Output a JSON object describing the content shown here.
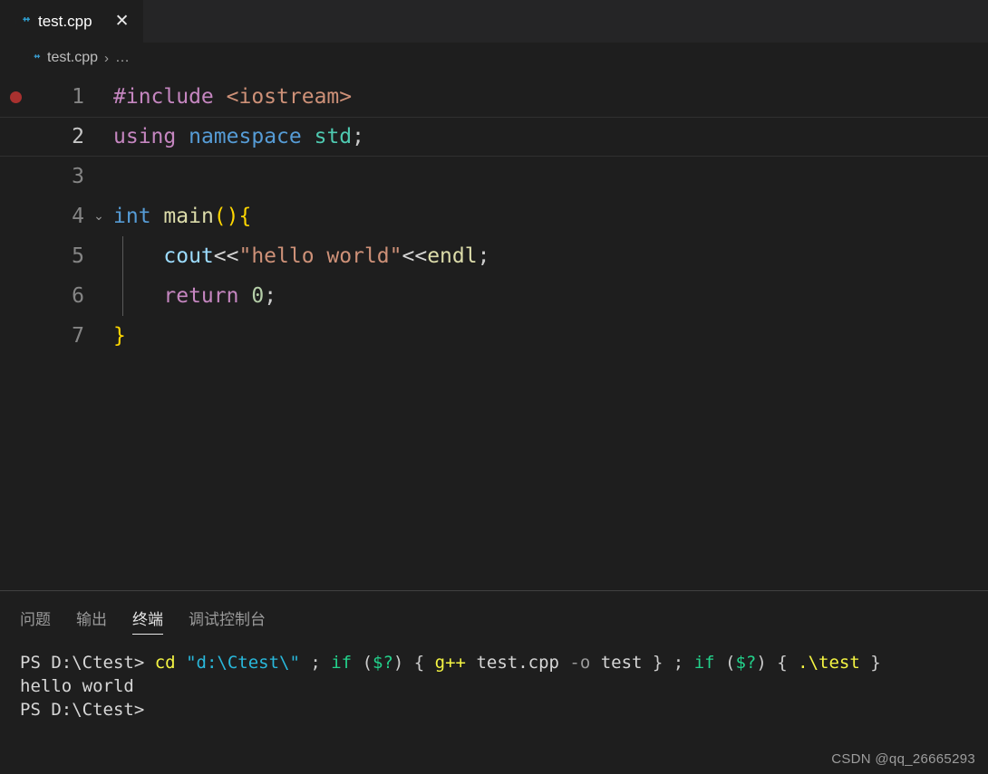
{
  "window": {
    "watermark": "CSDN @qq_26665293"
  },
  "tabbar": {
    "tabs": [
      {
        "label": "test.cpp",
        "icon": "cpp-file-icon",
        "close_glyph": "✕",
        "active": true
      }
    ]
  },
  "breadcrumbs": {
    "icon": "cpp-file-icon",
    "file": "test.cpp",
    "separator": "›",
    "overflow": "…"
  },
  "editor": {
    "language": "cpp",
    "breakpoint_line": 1,
    "active_line": 2,
    "lines": [
      {
        "number": "1",
        "breakpoint": true,
        "fold": "",
        "tokens": [
          {
            "text": "#include",
            "cls": "t-pre"
          },
          {
            "text": " ",
            "cls": "t-op"
          },
          {
            "text": "<iostream>",
            "cls": "t-inc"
          }
        ]
      },
      {
        "number": "2",
        "breakpoint": false,
        "fold": "",
        "active": true,
        "tokens": [
          {
            "text": "using",
            "cls": "t-kw"
          },
          {
            "text": " ",
            "cls": "t-op"
          },
          {
            "text": "namespace",
            "cls": "t-type"
          },
          {
            "text": " ",
            "cls": "t-op"
          },
          {
            "text": "std",
            "cls": "t-ns"
          },
          {
            "text": ";",
            "cls": "t-punct"
          }
        ]
      },
      {
        "number": "3",
        "breakpoint": false,
        "fold": "",
        "tokens": []
      },
      {
        "number": "4",
        "breakpoint": false,
        "fold": "⌄",
        "tokens": [
          {
            "text": "int",
            "cls": "t-type"
          },
          {
            "text": " ",
            "cls": "t-op"
          },
          {
            "text": "main",
            "cls": "t-fn"
          },
          {
            "text": "()",
            "cls": "t-par"
          },
          {
            "text": "{",
            "cls": "t-brace"
          }
        ]
      },
      {
        "number": "5",
        "breakpoint": false,
        "fold": "",
        "indent_guide": true,
        "tokens": [
          {
            "text": "    ",
            "cls": "t-op"
          },
          {
            "text": "cout",
            "cls": "t-var"
          },
          {
            "text": "<<",
            "cls": "t-op"
          },
          {
            "text": "\"hello world\"",
            "cls": "t-str"
          },
          {
            "text": "<<",
            "cls": "t-op"
          },
          {
            "text": "endl",
            "cls": "t-fn"
          },
          {
            "text": ";",
            "cls": "t-punct"
          }
        ]
      },
      {
        "number": "6",
        "breakpoint": false,
        "fold": "",
        "indent_guide": true,
        "tokens": [
          {
            "text": "    ",
            "cls": "t-op"
          },
          {
            "text": "return",
            "cls": "t-kw"
          },
          {
            "text": " ",
            "cls": "t-op"
          },
          {
            "text": "0",
            "cls": "t-num"
          },
          {
            "text": ";",
            "cls": "t-punct"
          }
        ]
      },
      {
        "number": "7",
        "breakpoint": false,
        "fold": "",
        "tokens": [
          {
            "text": "}",
            "cls": "t-brace"
          }
        ]
      }
    ]
  },
  "panel": {
    "tabs": [
      {
        "label": "问题",
        "active": false
      },
      {
        "label": "输出",
        "active": false
      },
      {
        "label": "终端",
        "active": true
      },
      {
        "label": "调试控制台",
        "active": false
      }
    ],
    "terminal": {
      "lines": [
        {
          "segments": [
            {
              "text": "PS D:\\Ctest> ",
              "cls": "tm-white"
            },
            {
              "text": "cd",
              "cls": "tm-yellow"
            },
            {
              "text": " ",
              "cls": "tm-white"
            },
            {
              "text": "\"d:\\Ctest\\\"",
              "cls": "tm-cyan"
            },
            {
              "text": " ; ",
              "cls": "tm-gray"
            },
            {
              "text": "if",
              "cls": "tm-green"
            },
            {
              "text": " (",
              "cls": "tm-gray"
            },
            {
              "text": "$?",
              "cls": "tm-green"
            },
            {
              "text": ") { ",
              "cls": "tm-gray"
            },
            {
              "text": "g++",
              "cls": "tm-yellow"
            },
            {
              "text": " test.cpp ",
              "cls": "tm-white"
            },
            {
              "text": "-o",
              "cls": "tm-dim"
            },
            {
              "text": " test ",
              "cls": "tm-white"
            },
            {
              "text": "} ; ",
              "cls": "tm-gray"
            },
            {
              "text": "if",
              "cls": "tm-green"
            },
            {
              "text": " (",
              "cls": "tm-gray"
            },
            {
              "text": "$?",
              "cls": "tm-green"
            },
            {
              "text": ") { ",
              "cls": "tm-gray"
            },
            {
              "text": ".\\test",
              "cls": "tm-yellow"
            },
            {
              "text": " }",
              "cls": "tm-gray"
            }
          ]
        },
        {
          "segments": [
            {
              "text": "hello world",
              "cls": "tm-white"
            }
          ]
        },
        {
          "segments": [
            {
              "text": "PS D:\\Ctest>",
              "cls": "tm-white"
            }
          ]
        }
      ]
    }
  }
}
